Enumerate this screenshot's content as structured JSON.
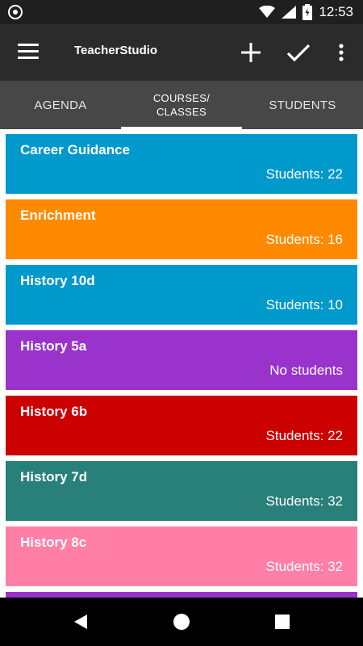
{
  "status": {
    "time": "12:53",
    "icons": [
      "wifi-icon",
      "signal-icon",
      "battery-icon"
    ]
  },
  "app": {
    "title": "TeacherStudio",
    "actions": [
      "add-icon",
      "check-icon",
      "more-vert-icon"
    ]
  },
  "tabs": [
    {
      "label": "AGENDA",
      "active": false
    },
    {
      "label": "COURSES/\nCLASSES",
      "active": true
    },
    {
      "label": "STUDENTS",
      "active": false
    }
  ],
  "courses": [
    {
      "name": "Career Guidance",
      "count": "Students: 22",
      "color": "#0099cc"
    },
    {
      "name": "Enrichment",
      "count": "Students: 16",
      "color": "#ff8a00"
    },
    {
      "name": "History 10d",
      "count": "Students: 10",
      "color": "#0099cc"
    },
    {
      "name": "History 5a",
      "count": "No students",
      "color": "#9933cc"
    },
    {
      "name": "History 6b",
      "count": "Students: 22",
      "color": "#cc0000"
    },
    {
      "name": "History 7d",
      "count": "Students: 32",
      "color": "#297f7a"
    },
    {
      "name": "History 8c",
      "count": "Students: 32",
      "color": "#ff7fa6"
    },
    {
      "name": "",
      "count": "",
      "color": "#9933cc"
    }
  ]
}
